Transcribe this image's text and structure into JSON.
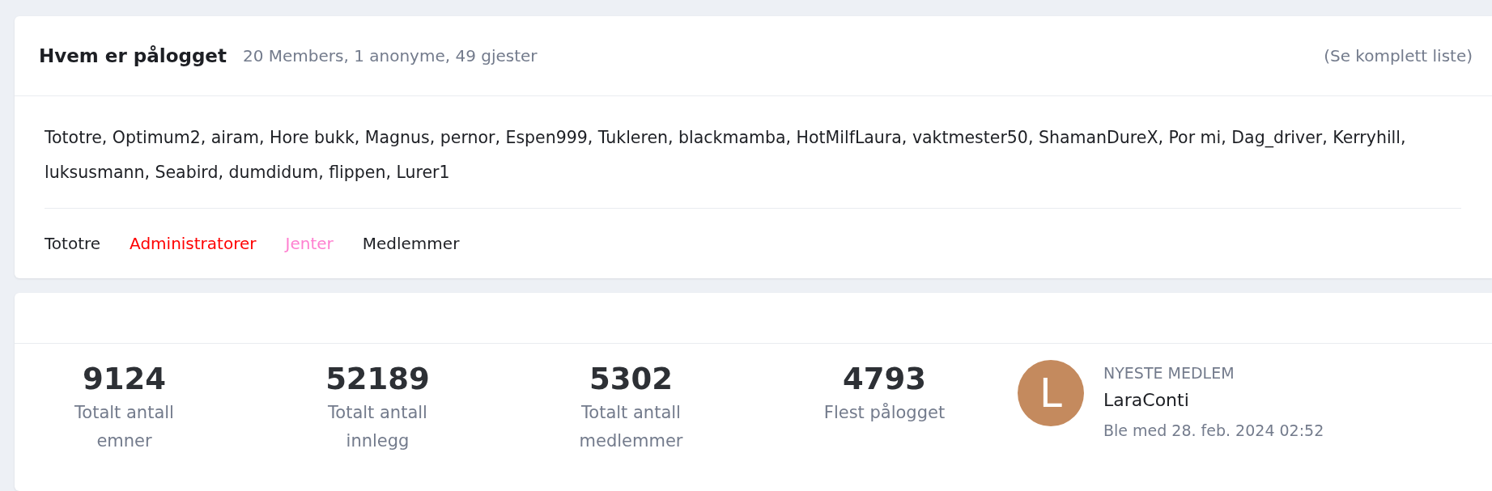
{
  "online": {
    "title": "Hvem er pålogget",
    "summary": "20 Members, 1 anonyme, 49 gjester",
    "full_list_link": "(Se komplett liste)",
    "users": "Tototre, Optimum2, airam, Hore bukk, Magnus, pernor, Espen999, Tukleren, blackmamba, HotMilfLaura, vaktmester50, ShamanDureX, Por mi, Dag_driver, Kerryhill, luksusmann, Seabird, dumdidum, flippen, Lurer1",
    "groups": [
      {
        "label": "Tototre",
        "color": "#1d1f24"
      },
      {
        "label": "Administratorer",
        "color": "#ff0000"
      },
      {
        "label": "Jenter",
        "color": "#ff7fd0"
      },
      {
        "label": "Medlemmer",
        "color": "#1d1f24"
      }
    ]
  },
  "stats": {
    "items": [
      {
        "value": "9124",
        "label": "Totalt antall emner"
      },
      {
        "value": "52189",
        "label": "Totalt antall innlegg"
      },
      {
        "value": "5302",
        "label": "Totalt antall medlemmer"
      },
      {
        "value": "4793",
        "label": "Flest pålogget"
      }
    ],
    "newest_member": {
      "heading": "NYESTE MEDLEM",
      "avatar_letter": "L",
      "name": "LaraConti",
      "joined": "Ble med 28. feb. 2024 02:52"
    }
  }
}
